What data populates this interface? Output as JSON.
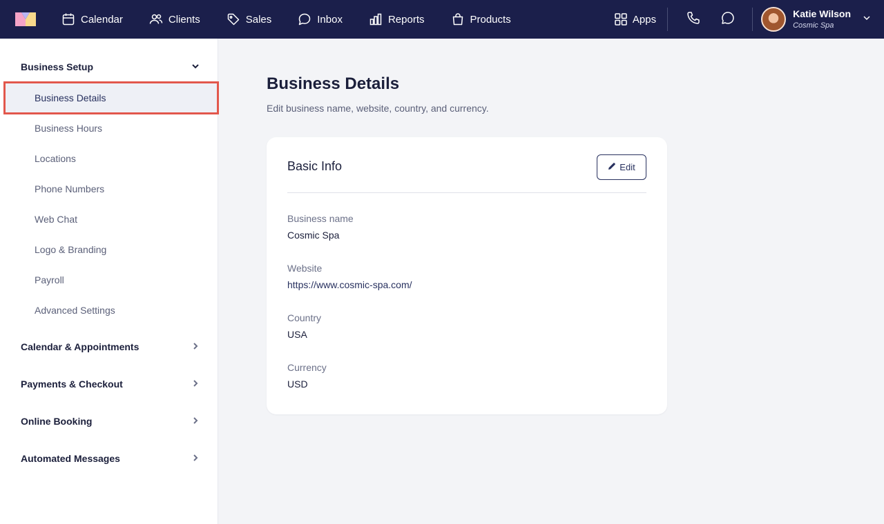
{
  "nav": {
    "items": [
      {
        "label": "Calendar",
        "icon": "calendar-icon"
      },
      {
        "label": "Clients",
        "icon": "users-icon"
      },
      {
        "label": "Sales",
        "icon": "tag-icon"
      },
      {
        "label": "Inbox",
        "icon": "chat-bubble-icon"
      },
      {
        "label": "Reports",
        "icon": "bar-chart-icon"
      },
      {
        "label": "Products",
        "icon": "shopping-bag-icon"
      }
    ],
    "apps_label": "Apps",
    "user": {
      "name": "Katie Wilson",
      "org": "Cosmic Spa"
    }
  },
  "sidebar": {
    "groups": [
      {
        "label": "Business Setup",
        "expanded": true,
        "items": [
          {
            "label": "Business Details",
            "active": true
          },
          {
            "label": "Business Hours"
          },
          {
            "label": "Locations"
          },
          {
            "label": "Phone Numbers"
          },
          {
            "label": "Web Chat"
          },
          {
            "label": "Logo & Branding"
          },
          {
            "label": "Payroll"
          },
          {
            "label": "Advanced Settings"
          }
        ]
      },
      {
        "label": "Calendar & Appointments",
        "expanded": false
      },
      {
        "label": "Payments & Checkout",
        "expanded": false
      },
      {
        "label": "Online Booking",
        "expanded": false
      },
      {
        "label": "Automated Messages",
        "expanded": false
      }
    ]
  },
  "main": {
    "title": "Business Details",
    "subtitle": "Edit business name, website, country, and currency.",
    "card": {
      "title": "Basic Info",
      "edit_label": "Edit",
      "fields": [
        {
          "label": "Business name",
          "value": "Cosmic Spa"
        },
        {
          "label": "Website",
          "value": "https://www.cosmic-spa.com/"
        },
        {
          "label": "Country",
          "value": "USA"
        },
        {
          "label": "Currency",
          "value": "USD"
        }
      ]
    }
  },
  "colors": {
    "topbar": "#1b1f4b",
    "highlight_border": "#e2574c",
    "accent": "#27305e"
  }
}
